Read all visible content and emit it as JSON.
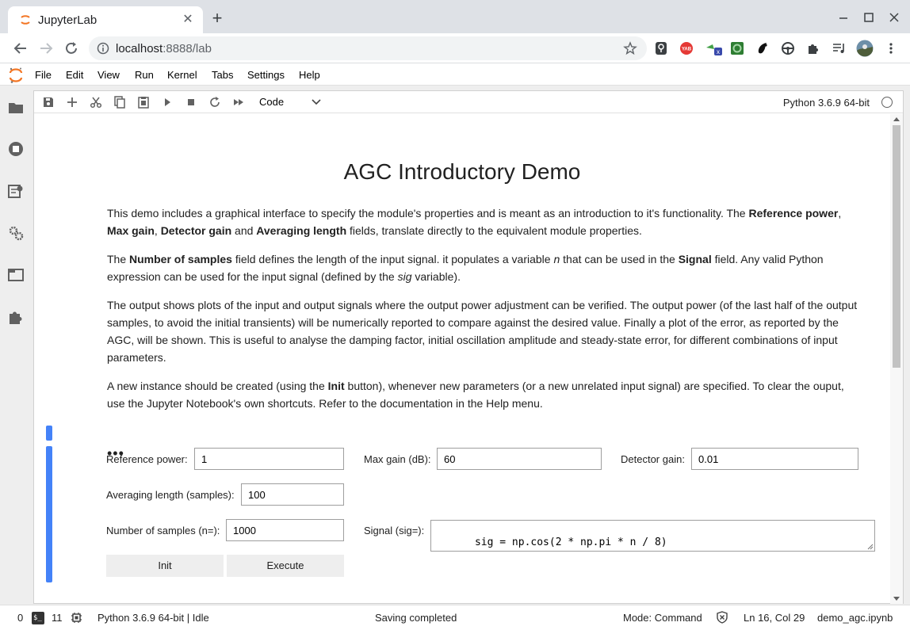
{
  "browser": {
    "tab_title": "JupyterLab",
    "url_host": "localhost",
    "url_rest": ":8888/lab"
  },
  "menubar": {
    "items": [
      "File",
      "Edit",
      "View",
      "Run",
      "Kernel",
      "Tabs",
      "Settings",
      "Help"
    ]
  },
  "notebook_toolbar": {
    "cell_type": "Code",
    "kernel": "Python 3.6.9 64-bit"
  },
  "markdown": {
    "title": "AGC Introductory Demo",
    "p1": {
      "a": "This demo includes a graphical interface to specify the module's properties and is meant as an introduction to it's functionality. The ",
      "b1": "Reference power",
      "c": ", ",
      "b2": "Max gain",
      "d": ", ",
      "b3": "Detector gain",
      "e": " and ",
      "b4": "Averaging length",
      "f": " fields, translate directly to the equivalent module properties."
    },
    "p2": {
      "a": "The ",
      "b1": "Number of samples",
      "c": " field defines the length of the input signal. it populates a variable ",
      "i1": "n",
      "d": " that can be used in the ",
      "b2": "Signal",
      "e": " field. Any valid Python expression can be used for the input signal (defined by the ",
      "i2": "sig",
      "f": " variable)."
    },
    "p3": "The output shows plots of the input and output signals where the output power adjustment can be verified. The output power (of the last half of the output samples, to avoid the initial transients) will be numerically reported to compare against the desired value. Finally a plot of the error, as reported by the AGC, will be shown. This is useful to analyse the damping factor, initial oscillation amplitude and steady-state error, for different combinations of input parameters.",
    "p4": {
      "a": "A new instance should be created (using the ",
      "b1": "Init",
      "c": " button), whenever new parameters (or a new unrelated input signal) are specified. To clear the ouput, use the Jupyter Notebook's own shortcuts. Refer to the documentation in the Help menu."
    }
  },
  "code_cell": {
    "collapsed_marker": "•••"
  },
  "widgets": {
    "reference_power_label": "Reference power:",
    "reference_power_value": "1",
    "max_gain_label": "Max gain (dB):",
    "max_gain_value": "60",
    "detector_gain_label": "Detector gain:",
    "detector_gain_value": "0.01",
    "averaging_length_label": "Averaging length (samples):",
    "averaging_length_value": "100",
    "num_samples_label": "Number of samples (n=):",
    "num_samples_value": "1000",
    "signal_label": "Signal (sig=):",
    "signal_value": "sig = np.cos(2 * np.pi * n / 8)",
    "init_button": "Init",
    "execute_button": "Execute"
  },
  "statusbar": {
    "count_zero": "0",
    "terminals": "11",
    "kernel_status": "Python 3.6.9 64-bit | Idle",
    "save_status": "Saving completed",
    "mode": "Mode: Command",
    "cursor": "Ln 16, Col 29",
    "filename": "demo_agc.ipynb"
  },
  "colors": {
    "jupyter_orange": "#f37726",
    "collapser_blue": "#4482f8"
  }
}
